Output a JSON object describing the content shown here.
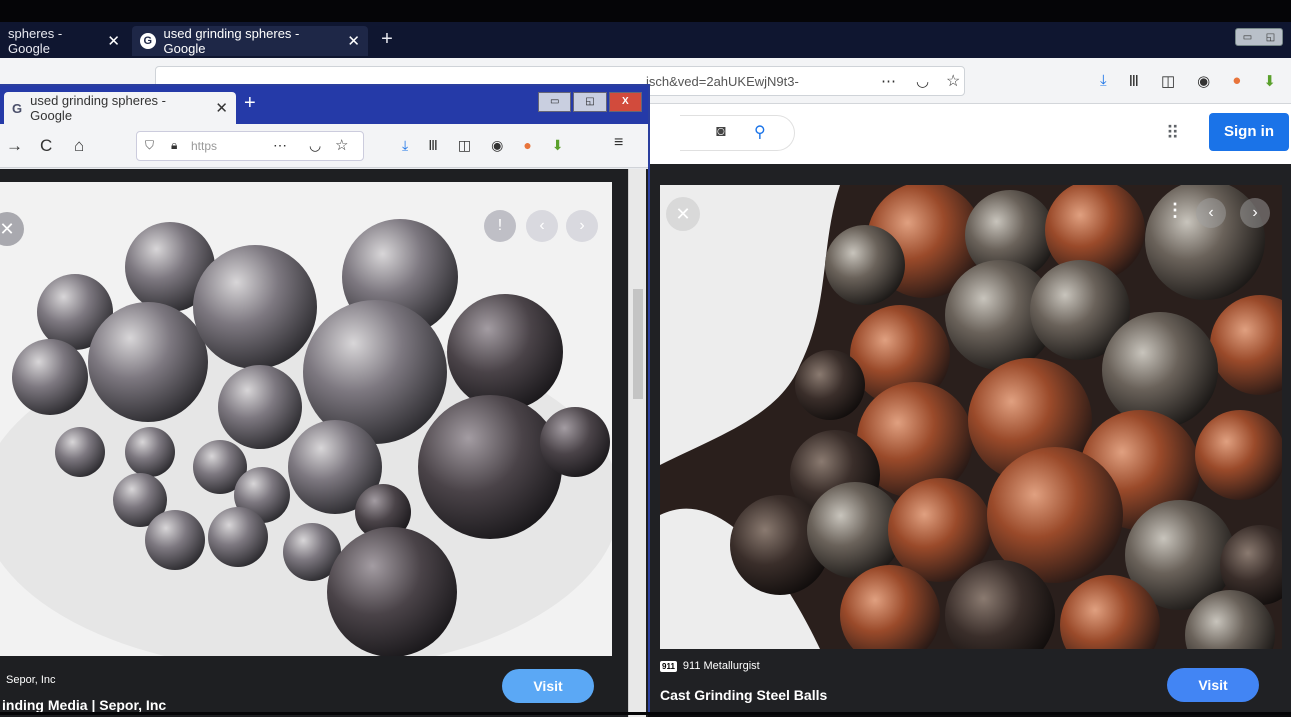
{
  "back_window": {
    "tabs": [
      {
        "label": "spheres - Google"
      },
      {
        "label": "used grinding spheres - Google"
      }
    ],
    "url_fragment": "isch&ved=2ahUKEwjN9t3-",
    "signin_label": "Sign in",
    "result": {
      "source": "911 Metallurgist",
      "source_favicon": "911",
      "title": "Cast Grinding Steel Balls",
      "visit_label": "Visit"
    }
  },
  "front_window": {
    "tab_label": "used grinding spheres - Google",
    "url_text": "https",
    "result": {
      "source": "Sepor, Inc",
      "title": "inding Media | Sepor, Inc",
      "visit_label": "Visit"
    }
  },
  "icons": {
    "close": "✕",
    "new_tab": "+",
    "back": "→",
    "reload": "C",
    "home": "⌂",
    "star": "☆",
    "more": "⋯",
    "apps": "⠿"
  },
  "colors": {
    "signin": "#1a73e8",
    "visit": "#4285f4",
    "front_titlebar": "#253aa8"
  }
}
